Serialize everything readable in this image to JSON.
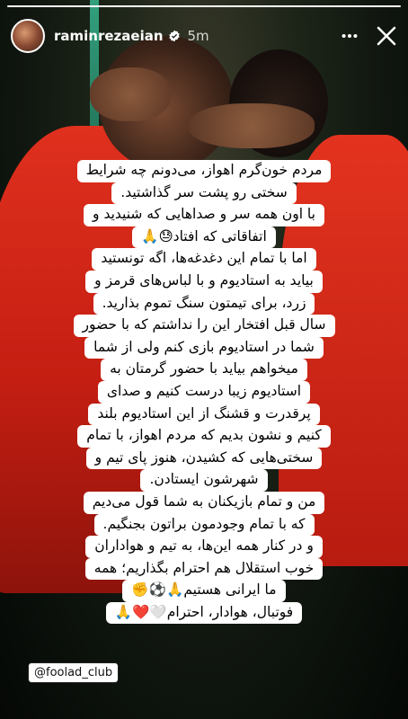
{
  "story": {
    "progress": 1.0,
    "username": "raminrezaeian",
    "timestamp": "5m",
    "icons": [
      "verified-badge-icon",
      "more-icon",
      "close-icon"
    ],
    "lines": [
      "مردم خون‌گرم اهواز، می‌دونم چه شرایط",
      "سختی رو پشت سر گذاشتید.",
      "با اون همه سر و صداهایی که شنیدید و",
      "اتفاقاتی که افتاد😓🙏",
      "اما با تمام این دغدغه‌ها، اگه تونستید",
      "بیاید به استادیوم و با لباس‌های قرمز و",
      "زرد، برای تیمتون سنگ تموم بذارید.",
      "سال قبل افتخار این را نداشتم که با حضور",
      "شما در استادیوم بازی کنم ولی از شما",
      "میخواهم  بیاید با حضور گرمتان به",
      "استادیوم زیبا درست کنیم و صدای",
      "پرقدرت و قشنگ از این استادیوم بلند",
      "کنیم و نشون بدیم که مردم اهواز، با تمام",
      "سختی‌هایی که کشیدن، هنوز پای تیم و",
      "شهرشون ایستادن.",
      "من و تمام بازیکنان به شما قول می‌دیم",
      "که با تمام وجودمون براتون بجنگیم.",
      "و در کنار همه این‌ها، به تیم و هواداران",
      "خوب استقلال هم احترام بگذاریم؛ همه",
      "ما ایرانی هستیم🙏⚽✊",
      "فوتبال، هوادار، احترام🤍❤️🙏"
    ],
    "mention": "@foolad_club",
    "colors": {
      "jersey": "#c41e12",
      "background": "#0d130d",
      "textbg": "#ffffff"
    }
  }
}
